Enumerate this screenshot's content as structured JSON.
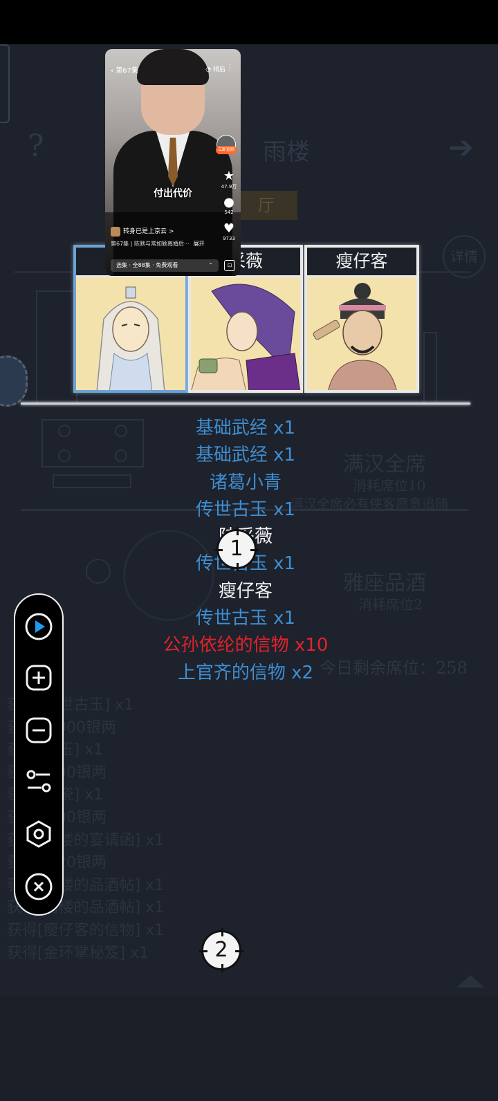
{
  "background_ui": {
    "help_icon_text": "?",
    "title_partial": "雨楼",
    "arrow_icon_text": "➔",
    "hall_tab_partial": "厅",
    "detail_button": "详情",
    "option1_title": "满汉全席",
    "option1_cost": "消耗席位10",
    "option1_desc": "满汉全席必有侠客愿意追随",
    "option2_title": "雅座品酒",
    "option2_cost": "消耗席位2",
    "seats_remaining": "今日剩余席位：258"
  },
  "log_lines": [
    "获得[传世古玉] x1",
    "获得10000银两",
    "获得[古玉] x1",
    "获得5000银两",
    "获得[白瓷] x1",
    "获得9200银两",
    "获得[雨楼的宴请函] x1",
    "获得6920银两",
    "获得[雨楼的品酒帖] x1",
    "获得[雨楼的品酒帖] x1",
    "获得[瘦仔客的信物] x1",
    "获得[金环掌秘笈] x1"
  ],
  "cards": [
    {
      "name": "诸葛小青",
      "name_visible": "诸",
      "selected": true
    },
    {
      "name": "陆采薇",
      "name_visible": "采薇",
      "selected": false
    },
    {
      "name": "瘦仔客",
      "name_visible": "瘦仔客",
      "selected": false
    }
  ],
  "rewards": [
    {
      "text": "基础武经 x1",
      "color": "#3f8ed2"
    },
    {
      "text": "基础武经 x1",
      "color": "#3f8ed2"
    },
    {
      "text": "诸葛小青",
      "color": "#3f8ed2"
    },
    {
      "text": "传世古玉 x1",
      "color": "#3f8ed2"
    },
    {
      "text": "陆采薇",
      "color": "#f3f3f3"
    },
    {
      "text": "传世古玉 x1",
      "color": "#3f8ed2"
    },
    {
      "text": "瘦仔客",
      "color": "#f3f3f3"
    },
    {
      "text": "传世古玉 x1",
      "color": "#3f8ed2"
    },
    {
      "text": "公孙依纶的信物 x10",
      "color": "#e2232b"
    },
    {
      "text": "上官齐的信物 x2",
      "color": "#3f8ed2"
    }
  ],
  "video": {
    "back_label": "第67集",
    "top_right_label": "稍后",
    "caption": "付出代价",
    "likes": "47.9万",
    "comments": "542",
    "hearts": "9733",
    "follow_label": "立即追剧",
    "author": "转身已是上京云 >",
    "description": "第67集 | 陈默与常如颖离婚后···",
    "expand_label": "展开",
    "episode_bar": "选集 · 全88集 · 免费观看"
  },
  "markers": [
    {
      "label": "1"
    },
    {
      "label": "2"
    }
  ],
  "toolbar_icons": [
    "play-icon",
    "zoom-in-icon",
    "zoom-out-icon",
    "sliders-icon",
    "settings-icon",
    "close-icon"
  ],
  "colors": {
    "accent_blue": "#3f8ed2",
    "play_blue": "#1e9bf0",
    "rare_red": "#e2232b"
  }
}
